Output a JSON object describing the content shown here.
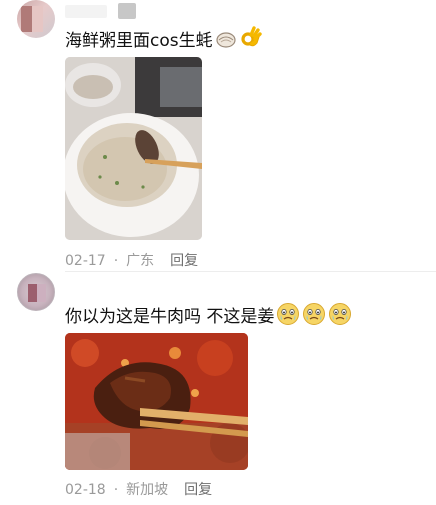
{
  "comments": [
    {
      "text": "海鲜粥里面cos生蚝",
      "emojis": [
        "oyster-emoji",
        "ok-hand-emoji"
      ],
      "photo": "seafood-congee-photo",
      "date": "02-17",
      "separator": "·",
      "location": "广东",
      "reply_label": "回复"
    },
    {
      "text": "你以为这是牛肉吗 不这是姜",
      "emojis": [
        "crying-face-emoji",
        "crying-face-emoji",
        "crying-face-emoji"
      ],
      "photo": "hot-pot-ginger-photo",
      "date": "02-18",
      "separator": "·",
      "location": "新加坡",
      "reply_label": "回复"
    }
  ]
}
